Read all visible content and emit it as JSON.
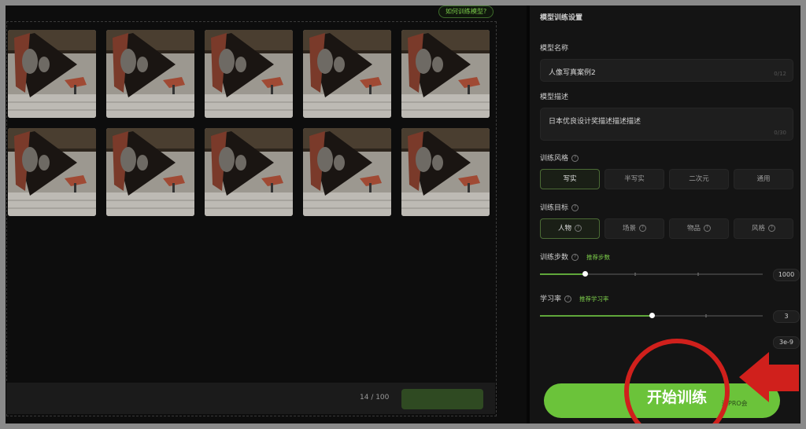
{
  "left": {
    "how_to_train_link": "如何训练模型?",
    "image_count": "14 / 100",
    "thumbnails": [
      {
        "alt": "sculpture"
      },
      {
        "alt": "sculpture"
      },
      {
        "alt": "sculpture"
      },
      {
        "alt": "sculpture"
      },
      {
        "alt": "sculpture"
      },
      {
        "alt": "sculpture"
      },
      {
        "alt": "sculpture"
      },
      {
        "alt": "sculpture"
      },
      {
        "alt": "sculpture"
      },
      {
        "alt": "sculpture"
      }
    ]
  },
  "settings": {
    "section_title": "模型训练设置",
    "model_name": {
      "label": "模型名称",
      "value": "人像写真案例2",
      "counter": "0/12"
    },
    "model_desc": {
      "label": "模型描述",
      "value": "日本优良设计奖描述描述描述",
      "counter": "0/30"
    },
    "style": {
      "label": "训练风格",
      "options": [
        "写实",
        "半写实",
        "二次元",
        "通用"
      ],
      "selected": "写实"
    },
    "target": {
      "label": "训练目标",
      "options": [
        "人物",
        "场景",
        "物品",
        "风格"
      ],
      "selected": "人物"
    },
    "steps": {
      "label": "训练步数",
      "hint": "推荐步数",
      "value": "1000",
      "fraction": 0.2
    },
    "learning_rate": {
      "label": "学习率",
      "hint": "推荐学习率",
      "value": "3",
      "fraction": 0.5,
      "exponent": "3e-9"
    },
    "start_button": "开始训练",
    "pro_tag": "通PRO会"
  },
  "colors": {
    "accent": "#6bc33a",
    "highlight": "#d0201c"
  }
}
